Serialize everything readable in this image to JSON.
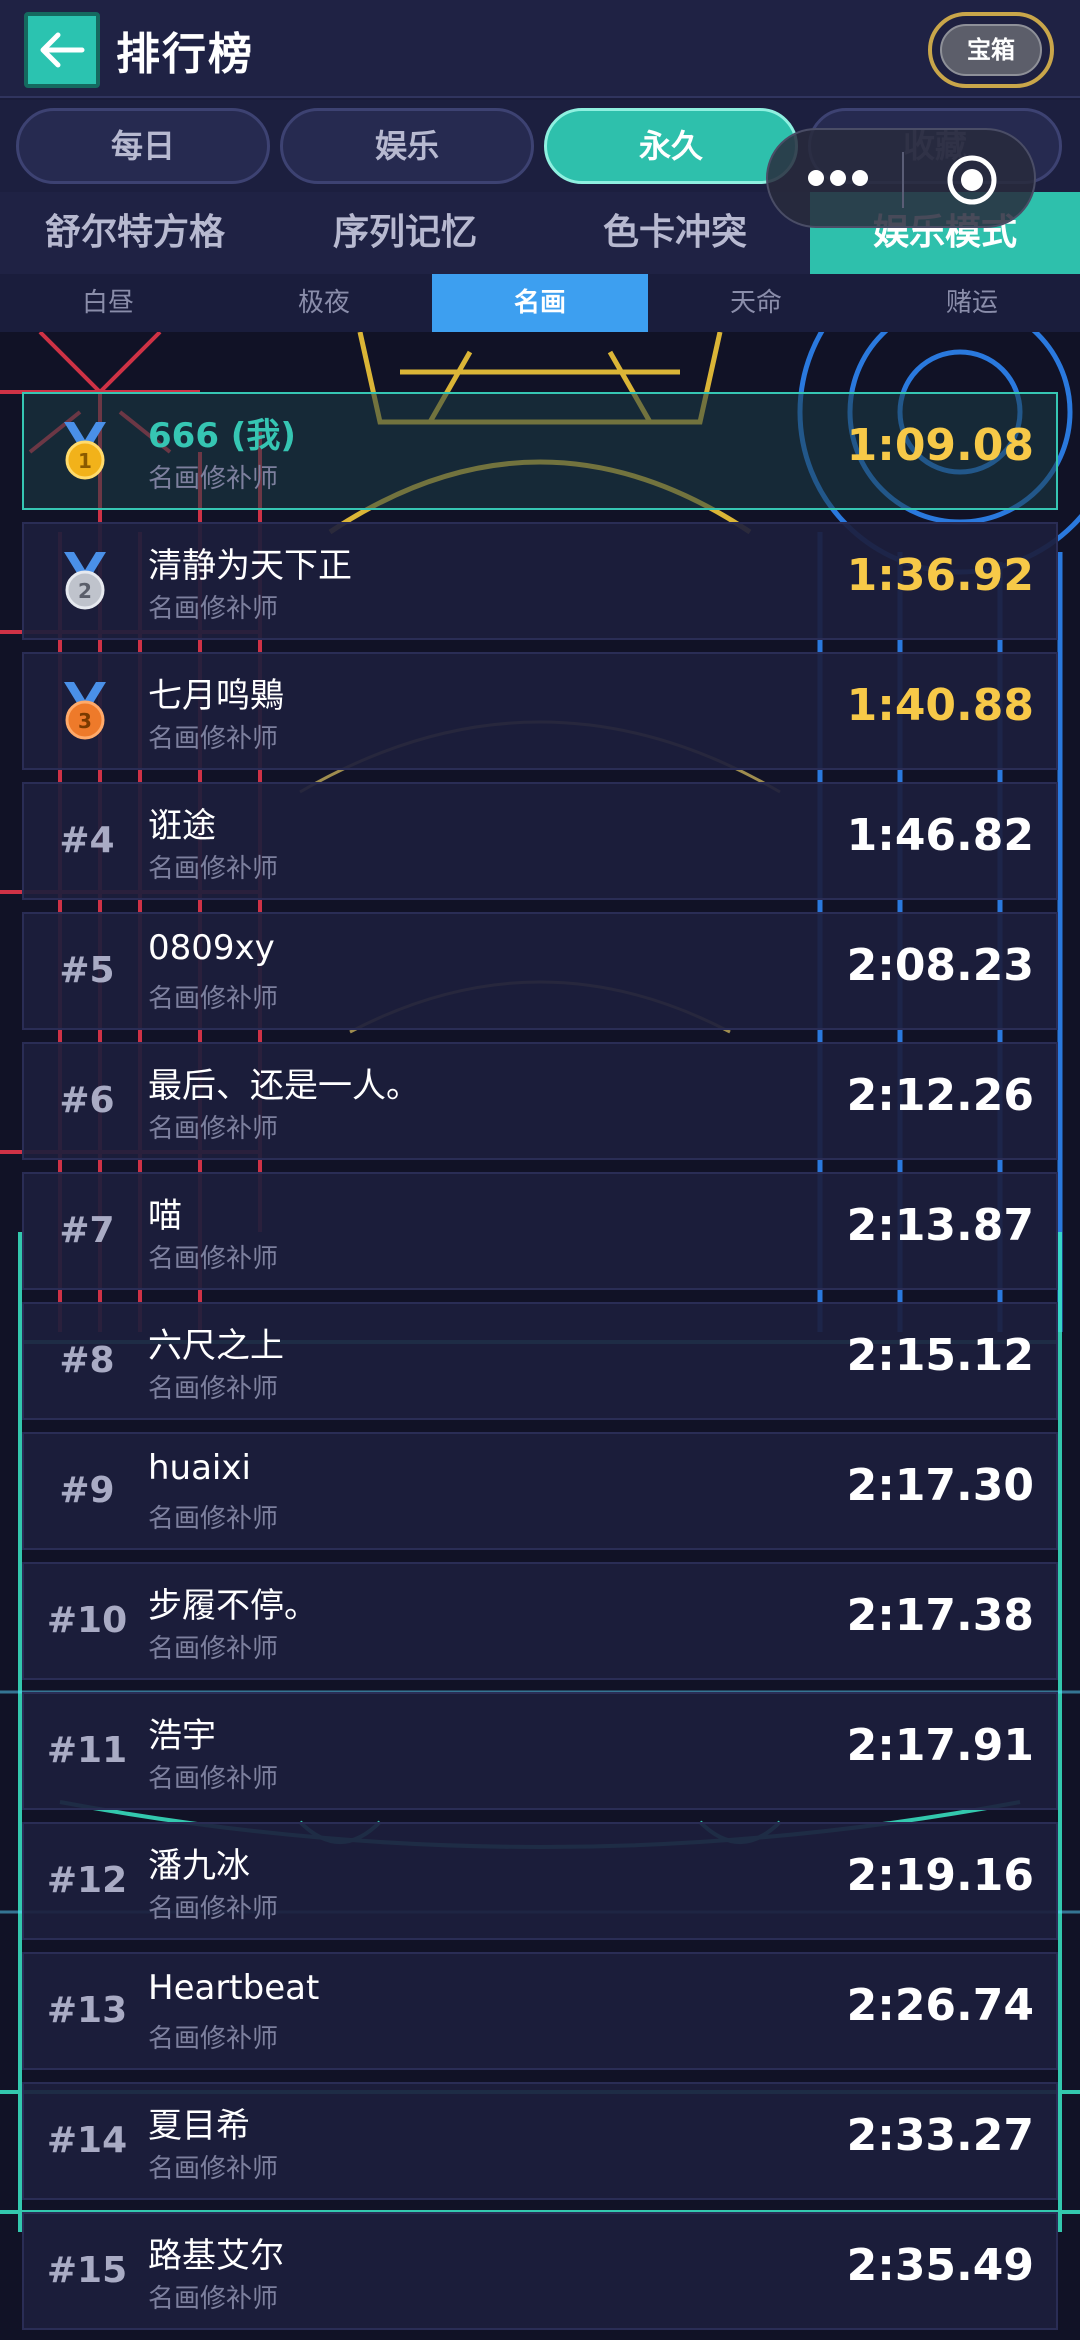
{
  "header": {
    "title": "排行榜",
    "chest_label": "宝箱"
  },
  "period_tabs": [
    {
      "label": "每日",
      "active": false
    },
    {
      "label": "娱乐",
      "active": false
    },
    {
      "label": "永久",
      "active": true
    },
    {
      "label": "收藏",
      "active": false
    }
  ],
  "mode_tabs": [
    {
      "label": "舒尔特方格",
      "active": false
    },
    {
      "label": "序列记忆",
      "active": false
    },
    {
      "label": "色卡冲突",
      "active": false
    },
    {
      "label": "娱乐模式",
      "active": true
    }
  ],
  "sub_tabs": [
    {
      "label": "白昼",
      "active": false
    },
    {
      "label": "极夜",
      "active": false
    },
    {
      "label": "名画",
      "active": true
    },
    {
      "label": "天命",
      "active": false
    },
    {
      "label": "赌运",
      "active": false
    }
  ],
  "leaderboard": [
    {
      "rank": "1",
      "medal": "gold-medal-icon",
      "name": "666 (我)",
      "title": "名画修补师",
      "time": "1:09.08",
      "is_me": true
    },
    {
      "rank": "2",
      "medal": "silver-medal-icon",
      "name": "清静为天下正",
      "title": "名画修补师",
      "time": "1:36.92",
      "is_me": false
    },
    {
      "rank": "3",
      "medal": "bronze-medal-icon",
      "name": "七月鸣鶪",
      "title": "名画修补师",
      "time": "1:40.88",
      "is_me": false
    },
    {
      "rank": "#4",
      "name": "诳途",
      "title": "名画修补师",
      "time": "1:46.82",
      "is_me": false
    },
    {
      "rank": "#5",
      "name": "0809xy",
      "title": "名画修补师",
      "time": "2:08.23",
      "is_me": false
    },
    {
      "rank": "#6",
      "name": "最后、还是一人。",
      "title": "名画修补师",
      "time": "2:12.26",
      "is_me": false
    },
    {
      "rank": "#7",
      "name": "喵",
      "title": "名画修补师",
      "time": "2:13.87",
      "is_me": false
    },
    {
      "rank": "#8",
      "name": "六尺之上",
      "title": "名画修补师",
      "time": "2:15.12",
      "is_me": false
    },
    {
      "rank": "#9",
      "name": "huaixi",
      "title": "名画修补师",
      "time": "2:17.30",
      "is_me": false
    },
    {
      "rank": "#10",
      "name": "步履不停。",
      "title": "名画修补师",
      "time": "2:17.38",
      "is_me": false
    },
    {
      "rank": "#11",
      "name": "浩宇",
      "title": "名画修补师",
      "time": "2:17.91",
      "is_me": false
    },
    {
      "rank": "#12",
      "name": "潘九冰",
      "title": "名画修补师",
      "time": "2:19.16",
      "is_me": false
    },
    {
      "rank": "#13",
      "name": "Heartbeat",
      "title": "名画修补师",
      "time": "2:26.74",
      "is_me": false
    },
    {
      "rank": "#14",
      "name": "夏目希",
      "title": "名画修补师",
      "time": "2:33.27",
      "is_me": false
    },
    {
      "rank": "#15",
      "name": "路基艾尔",
      "title": "名画修补师",
      "time": "2:35.49",
      "is_me": false
    }
  ],
  "colors": {
    "accent": "#2ec0ac",
    "sub_accent": "#3d9ff0",
    "gold_time": "#f7c948",
    "background": "#1a1c3a"
  }
}
